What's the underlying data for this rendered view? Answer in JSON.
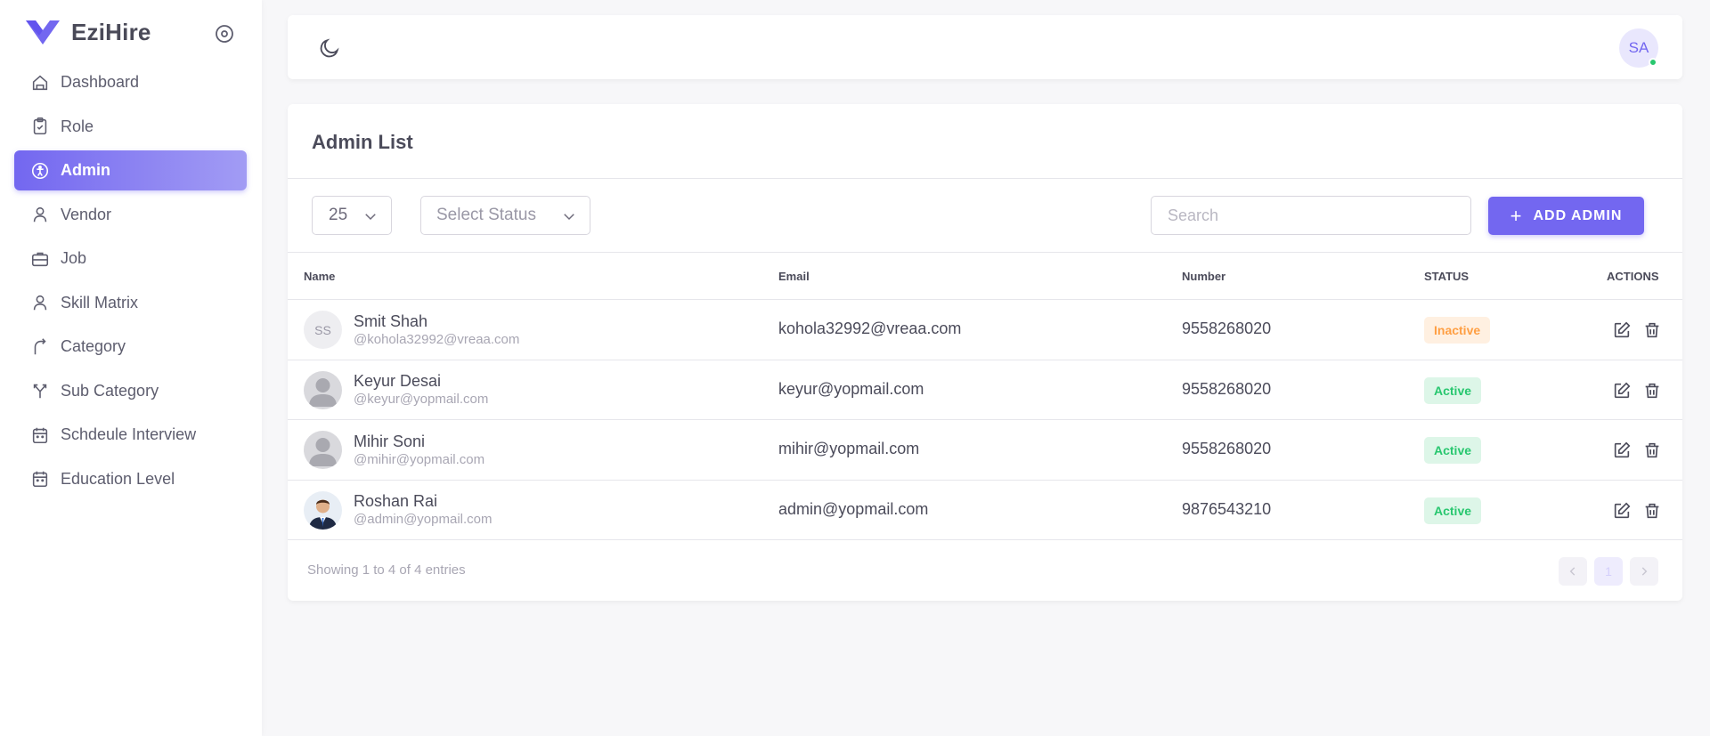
{
  "brand": {
    "name": "EziHire"
  },
  "sidebar": {
    "items": [
      {
        "label": "Dashboard",
        "icon": "home-icon"
      },
      {
        "label": "Role",
        "icon": "clipboard-check-icon"
      },
      {
        "label": "Admin",
        "icon": "accessibility-icon",
        "active": true
      },
      {
        "label": "Vendor",
        "icon": "user-icon"
      },
      {
        "label": "Job",
        "icon": "briefcase-icon"
      },
      {
        "label": "Skill Matrix",
        "icon": "user-icon"
      },
      {
        "label": "Category",
        "icon": "arrow-up-right-icon"
      },
      {
        "label": "Sub Category",
        "icon": "split-arrow-icon"
      },
      {
        "label": "Schdeule Interview",
        "icon": "calendar-icon"
      },
      {
        "label": "Education Level",
        "icon": "calendar-icon"
      }
    ]
  },
  "topbar": {
    "user_initials": "SA"
  },
  "admin_list": {
    "title": "Admin List",
    "per_page": "25",
    "status_placeholder": "Select Status",
    "search_placeholder": "Search",
    "add_label": "ADD ADMIN",
    "columns": {
      "name": "Name",
      "email": "Email",
      "number": "Number",
      "status": "STATUS",
      "actions": "ACTIONS"
    },
    "rows": [
      {
        "initials": "SS",
        "name": "Smit Shah",
        "handle": "@kohola32992@vreaa.com",
        "email": "kohola32992@vreaa.com",
        "number": "9558268020",
        "status": "Inactive"
      },
      {
        "initials": "",
        "name": "Keyur Desai",
        "handle": "@keyur@yopmail.com",
        "email": "keyur@yopmail.com",
        "number": "9558268020",
        "status": "Active"
      },
      {
        "initials": "",
        "name": "Mihir Soni",
        "handle": "@mihir@yopmail.com",
        "email": "mihir@yopmail.com",
        "number": "9558268020",
        "status": "Active"
      },
      {
        "initials": "",
        "name": "Roshan Rai",
        "handle": "@admin@yopmail.com",
        "email": "admin@yopmail.com",
        "number": "9876543210",
        "status": "Active"
      }
    ],
    "footer": "Showing 1 to 4 of 4 entries",
    "pagination": {
      "current": "1"
    }
  },
  "colors": {
    "primary": "#7367f0",
    "active": "#28c76f",
    "inactive": "#ff9f43"
  }
}
